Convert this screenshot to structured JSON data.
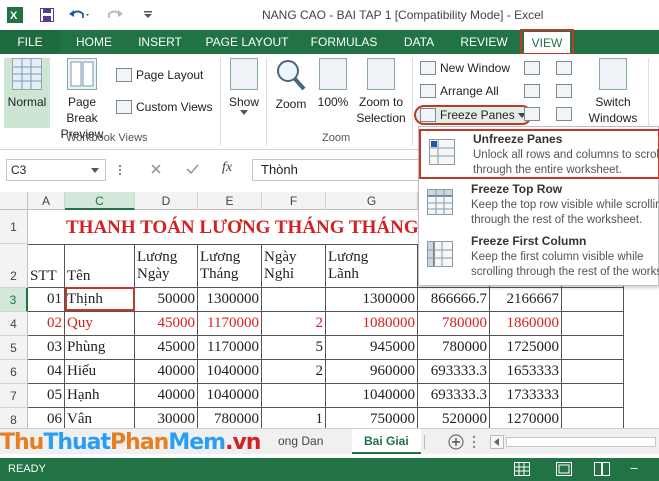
{
  "titlebar": {
    "title": "NANG CAO - BAI TAP 1  [Compatibility Mode] - Excel"
  },
  "tabs": [
    "FILE",
    "HOME",
    "INSERT",
    "PAGE LAYOUT",
    "FORMULAS",
    "DATA",
    "REVIEW",
    "VIEW"
  ],
  "ribbon": {
    "normal": "Normal",
    "page_break_1": "Page Break",
    "page_break_2": "Preview",
    "page_layout": "Page Layout",
    "custom_views": "Custom Views",
    "workbook_views": "Workbook Views",
    "show": "Show",
    "zoom": "Zoom",
    "zoom100": "100%",
    "zoom_sel_1": "Zoom to",
    "zoom_sel_2": "Selection",
    "zoom_group": "Zoom",
    "new_window": "New Window",
    "arrange_all": "Arrange All",
    "freeze_panes": "Freeze Panes",
    "switch_1": "Switch",
    "switch_2": "Windows"
  },
  "freeze_menu": [
    {
      "title": "Unfreeze Panes",
      "desc1": "Unlock all rows and columns to scroll",
      "desc2": "through the entire worksheet."
    },
    {
      "title": "Freeze Top Row",
      "desc1": "Keep the top row visible while scrolling",
      "desc2": "through the rest of the worksheet."
    },
    {
      "title": "Freeze First Column",
      "desc1": "Keep the first column visible while",
      "desc2": "scrolling through the rest of the worksheet."
    }
  ],
  "formula_bar": {
    "name_box": "C3",
    "fx": "fx",
    "content": "Thònh"
  },
  "columns": [
    "A",
    "C",
    "D",
    "E",
    "F",
    "G"
  ],
  "rows": [
    "1",
    "2",
    "3",
    "4",
    "5",
    "6",
    "7",
    "8"
  ],
  "sheet": {
    "title": "THANH TOÁN LƯƠNG THÁNG THÁNG",
    "headers": {
      "stt": "STT",
      "ten": "Tên",
      "luong_ngay_1": "Lương",
      "luong_ngay_2": "Ngày",
      "luong_thang_1": "Lương",
      "luong_thang_2": "Tháng",
      "ngay_nghi_1": "Ngày",
      "ngay_nghi_2": "Nghỉ",
      "luong_lanh_1": "Lương",
      "luong_lanh_2": "Lãnh"
    },
    "data": [
      [
        "01",
        "Thịnh",
        "50000",
        "1300000",
        "",
        "1300000",
        "866666.7",
        "2166667"
      ],
      [
        "02",
        "Quy",
        "45000",
        "1170000",
        "2",
        "1080000",
        "780000",
        "1860000"
      ],
      [
        "03",
        "Phùng",
        "45000",
        "1170000",
        "5",
        "945000",
        "780000",
        "1725000"
      ],
      [
        "04",
        "Hiếu",
        "40000",
        "1040000",
        "2",
        "960000",
        "693333.3",
        "1653333"
      ],
      [
        "05",
        "Hạnh",
        "40000",
        "1040000",
        "",
        "1040000",
        "693333.3",
        "1733333"
      ],
      [
        "06",
        "Vân",
        "30000",
        "780000",
        "1",
        "750000",
        "520000",
        "1270000"
      ]
    ]
  },
  "sheet_tabs": {
    "partial": "ong Dan",
    "active": "Bai Giai"
  },
  "watermark": {
    "part1": "Thu",
    "part2": "Thuat",
    "part3": "Phan",
    "part4": "Mem",
    "part5": ".vn"
  },
  "status": "READY",
  "colors": {
    "excel_green": "#217346",
    "highlight_red": "#c0392b",
    "data_red": "#d32020"
  }
}
